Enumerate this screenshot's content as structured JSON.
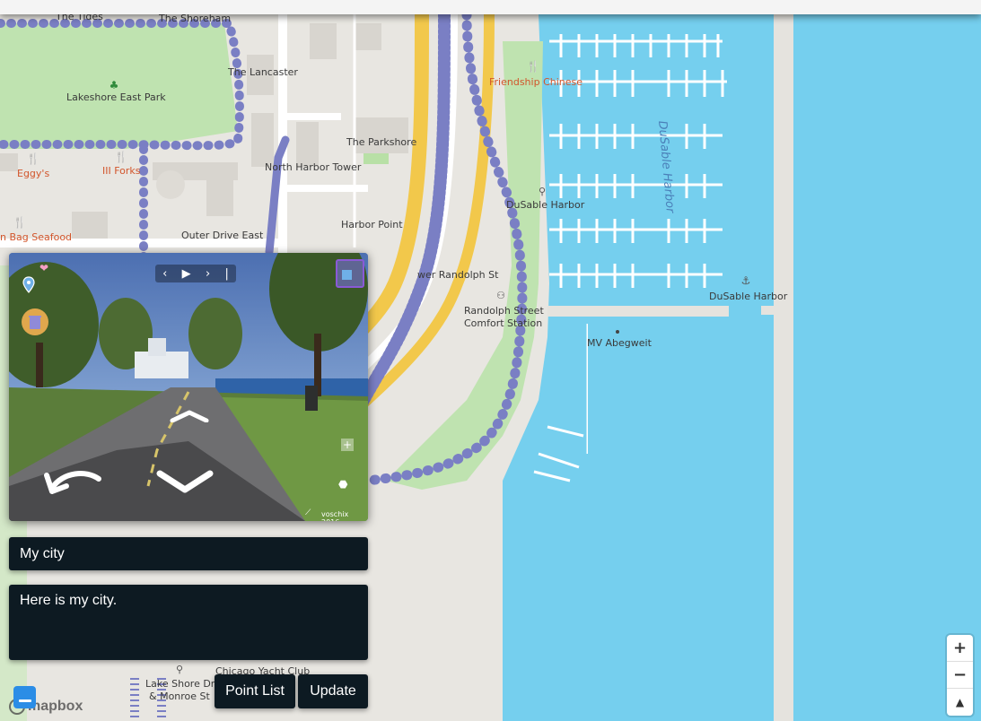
{
  "map": {
    "labels": {
      "the_tides": "The Tides",
      "the_shoreham": "The Shoreham",
      "the_lancaster": "The Lancaster",
      "friendship_chinese": "Friendship Chinese",
      "lakeshore_east_park": "Lakeshore East Park",
      "the_parkshore": "The Parkshore",
      "eggys": "Eggy's",
      "iii_forks": "III Forks",
      "north_harbor_tower": "North Harbor Tower",
      "dusable_harbor_water": "DuSable Harbor",
      "dusable_harbor_bike": "DuSable Harbor",
      "harbor_point": "Harbor Point",
      "bag_seafood": "n Bag Seafood",
      "outer_drive_east": "Outer Drive East",
      "randolph_st_road": "wer Randolph St",
      "dusable_harbor_anchor": "DuSable Harbor",
      "randolph_comfort_1": "Randolph Street",
      "randolph_comfort_2": "Comfort Station",
      "mv_abegweit": "MV Abegweit",
      "chicago_yacht_club": "Chicago Yacht Club",
      "lake_shore_dr_1": "Lake Shore Dr",
      "lake_shore_dr_2": "& Monroe St"
    },
    "colors": {
      "water": "#75cfee",
      "park": "#bfe3b0",
      "land": "#e8e6e1",
      "route": "#7a7fc4",
      "highway": "#f2c84b"
    }
  },
  "viewer": {
    "credit": "voschix 2016",
    "icons": [
      "heart-icon",
      "map-pin-icon",
      "trash-icon",
      "prev-icon",
      "play-icon",
      "next-icon",
      "end-icon",
      "fullscreen-icon",
      "back-arrow-icon",
      "forward-chevron-icon",
      "down-chevron-icon",
      "plus-icon",
      "compass-icon"
    ]
  },
  "form": {
    "title_value": "My city",
    "description_value": "Here is my city."
  },
  "buttons": {
    "point_list": "Point List",
    "update": "Update"
  },
  "zoom": {
    "in": "+",
    "out": "−",
    "compass": "▲"
  },
  "attribution": {
    "logo_text": "mapbox"
  }
}
